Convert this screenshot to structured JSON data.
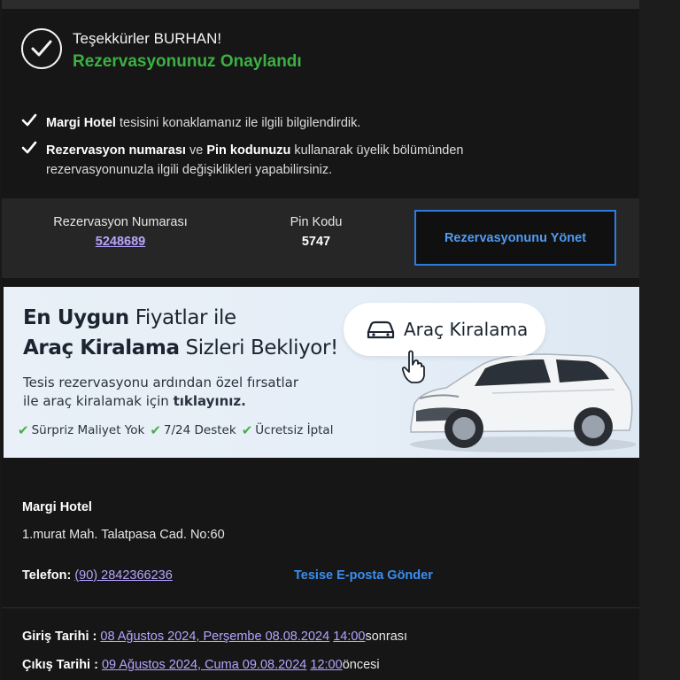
{
  "header": {
    "greeting": "Teşekkürler BURHAN!",
    "status": "Rezervasyonunuz Onaylandı"
  },
  "info": {
    "line1_bold": "Margi Hotel",
    "line1_rest": " tesisini konaklamanız ile ilgili bilgilendirdik.",
    "line2_bold1": "Rezervasyon numarası",
    "line2_mid": " ve ",
    "line2_bold2": "Pin kodunuzu",
    "line2_rest": " kullanarak üyelik bölümünden",
    "line3": "rezervasyonunuzla ilgili değişiklikleri yapabilirsiniz."
  },
  "reservation": {
    "number_label": "Rezervasyon Numarası",
    "number_value": "5248689",
    "pin_label": "Pin Kodu",
    "pin_value": "5747",
    "manage_button": "Rezervasyonunu Yönet"
  },
  "banner": {
    "line1_bold": "En Uygun",
    "line1_rest": " Fiyatlar ile",
    "line2_bold": "Araç Kiralama",
    "line2_rest": " Sizleri Bekliyor!",
    "sub1": "Tesis rezervasyonu ardından özel fırsatlar",
    "sub2_rest": "ile araç kiralamak için ",
    "sub2_bold": "tıklayınız.",
    "pill": "Araç Kiralama",
    "features": [
      "Sürpriz Maliyet Yok",
      "7/24 Destek",
      "Ücretsiz İptal"
    ]
  },
  "hotel": {
    "name": "Margi Hotel",
    "address": "1.murat Mah. Talatpasa Cad. No:60",
    "phone_label": "Telefon:",
    "phone_value": "(90) 2842366236",
    "email_link": "Tesise E-posta Gönder"
  },
  "dates": {
    "checkin_label": "Giriş Tarihi :",
    "checkin_date": "08 Ağustos 2024, Perşembe 08.08.2024",
    "checkin_time": "14:00",
    "checkin_suffix": "sonrası",
    "checkout_label": "Çıkış Tarihi :",
    "checkout_date": "09 Ağustos 2024, Cuma 09.08.2024",
    "checkout_time": "12:00",
    "checkout_suffix": "öncesi"
  },
  "colors": {
    "accent_green": "#3cb043",
    "link_purple": "#b7a4ff",
    "link_blue": "#3b8ef0",
    "button_border": "#2e7be0"
  }
}
